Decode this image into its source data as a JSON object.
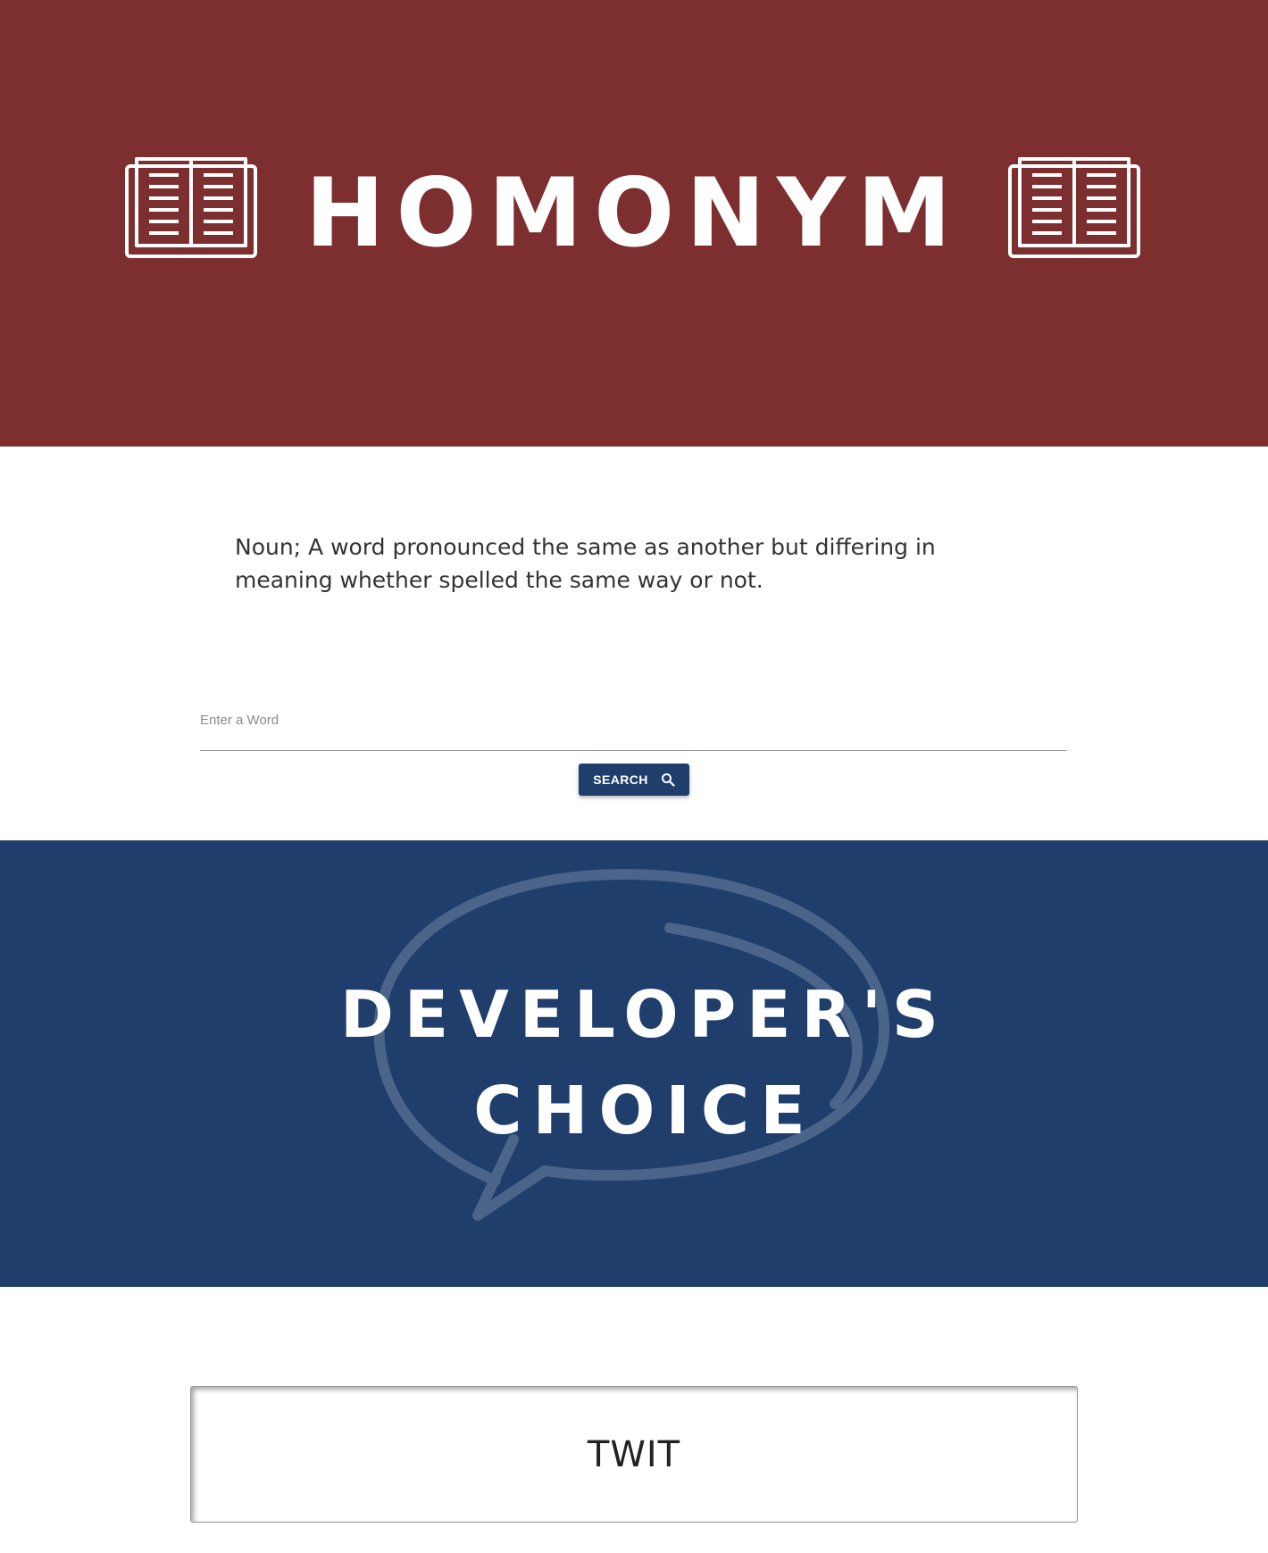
{
  "header": {
    "brand": "HOMONYM",
    "icons": [
      "open-book-icon",
      "open-book-icon"
    ],
    "background": "#7d2f2f"
  },
  "intro": {
    "definition": "Noun; A word pronounced the same as another but differing in meaning whether spelled the same way or not."
  },
  "search": {
    "label": "Enter a Word",
    "value": "",
    "button_label": "SEARCH",
    "button_icon": "search-icon",
    "button_color": "#1f3e6c"
  },
  "developers_choice": {
    "line1": "DEVELOPER'S",
    "line2": "CHOICE",
    "icon": "speech-bubble-icon",
    "background": "#1f3e6c"
  },
  "result": {
    "word": "TWIT"
  }
}
